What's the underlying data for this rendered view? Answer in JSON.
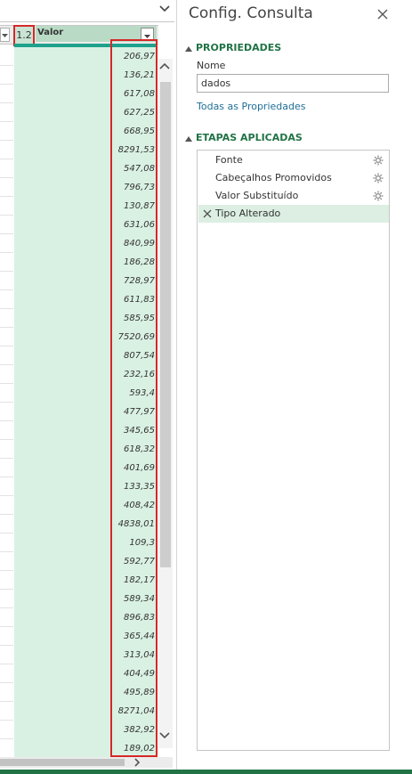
{
  "pane": {
    "title": "Config. Consulta",
    "properties_heading": "PROPRIEDADES",
    "name_label": "Nome",
    "name_value": "dados",
    "all_properties_link": "Todas as Propriedades",
    "steps_heading": "ETAPAS APLICADAS",
    "steps": [
      {
        "label": "Fonte",
        "has_settings": true,
        "selected": false
      },
      {
        "label": "Cabeçalhos Promovidos",
        "has_settings": true,
        "selected": false
      },
      {
        "label": "Valor Substituído",
        "has_settings": true,
        "selected": false
      },
      {
        "label": "Tipo Alterado",
        "has_settings": false,
        "selected": true
      }
    ]
  },
  "grid": {
    "column": {
      "type_badge": "1.2",
      "name": "Valor"
    },
    "values": [
      "206,97",
      "136,21",
      "617,08",
      "627,25",
      "668,95",
      "8291,53",
      "547,08",
      "796,73",
      "130,87",
      "631,06",
      "840,99",
      "186,28",
      "728,97",
      "611,83",
      "585,95",
      "7520,69",
      "807,54",
      "232,16",
      "593,4",
      "477,97",
      "345,65",
      "618,32",
      "401,69",
      "133,35",
      "408,42",
      "4838,01",
      "109,3",
      "592,77",
      "182,17",
      "589,34",
      "896,83",
      "365,44",
      "313,04",
      "404,49",
      "495,89",
      "8271,04",
      "382,92",
      "189,02"
    ]
  },
  "colors": {
    "accent_green": "#217346",
    "selected_column": "#d9f1e3",
    "highlight_red": "#d62828",
    "link_blue": "#1e6f97"
  },
  "icons": {
    "formula_expand": "chevron-down-icon",
    "close": "close-icon",
    "step_settings": "gear-icon",
    "step_delete": "x-icon",
    "collapse": "triangle-up-icon"
  }
}
